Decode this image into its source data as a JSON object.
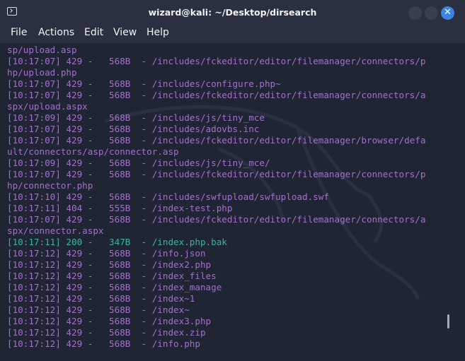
{
  "window": {
    "title": "wizard@kali: ~/Desktop/dirsearch",
    "close_glyph": "✕",
    "controls": [
      "minimize-icon",
      "maximize-icon",
      "close-icon"
    ]
  },
  "menu": {
    "file": "File",
    "actions": "Actions",
    "edit": "Edit",
    "view": "View",
    "help": "Help"
  },
  "terminal": {
    "colors": {
      "background": "#202534",
      "text": "#9f73c9",
      "success": "#39b4a0"
    },
    "lines": [
      "sp/upload.asp",
      "[10:17:07] 429 -   568B  - /includes/fckeditor/editor/filemanager/connectors/p",
      "hp/upload.php",
      "[10:17:07] 429 -   568B  - /includes/configure.php~",
      "[10:17:07] 429 -   568B  - /includes/fckeditor/editor/filemanager/connectors/a",
      "spx/upload.aspx",
      "[10:17:09] 429 -   568B  - /includes/js/tiny_mce",
      "[10:17:07] 429 -   568B  - /includes/adovbs.inc",
      "[10:17:07] 429 -   568B  - /includes/fckeditor/editor/filemanager/browser/defa",
      "ult/connectors/asp/connector.asp",
      "[10:17:09] 429 -   568B  - /includes/js/tiny_mce/",
      "[10:17:07] 429 -   568B  - /includes/fckeditor/editor/filemanager/connectors/p",
      "hp/connector.php",
      "[10:17:10] 429 -   568B  - /includes/swfupload/swfupload.swf",
      "[10:17:11] 404 -   555B  - /index-test.php",
      "[10:17:07] 429 -   568B  - /includes/fckeditor/editor/filemanager/connectors/a",
      "spx/connector.aspx",
      "[10:17:11] 200 -   347B  - /index.php.bak",
      "[10:17:12] 429 -   568B  - /info.json",
      "[10:17:12] 429 -   568B  - /index2.php",
      "[10:17:12] 429 -   568B  - /index_files",
      "[10:17:12] 429 -   568B  - /index_manage",
      "[10:17:12] 429 -   568B  - /index~1",
      "[10:17:12] 429 -   568B  - /index~",
      "[10:17:12] 429 -   568B  - /index3.php",
      "[10:17:12] 429 -   568B  - /index.zip",
      "[10:17:12] 429 -   568B  - /info.php"
    ]
  }
}
